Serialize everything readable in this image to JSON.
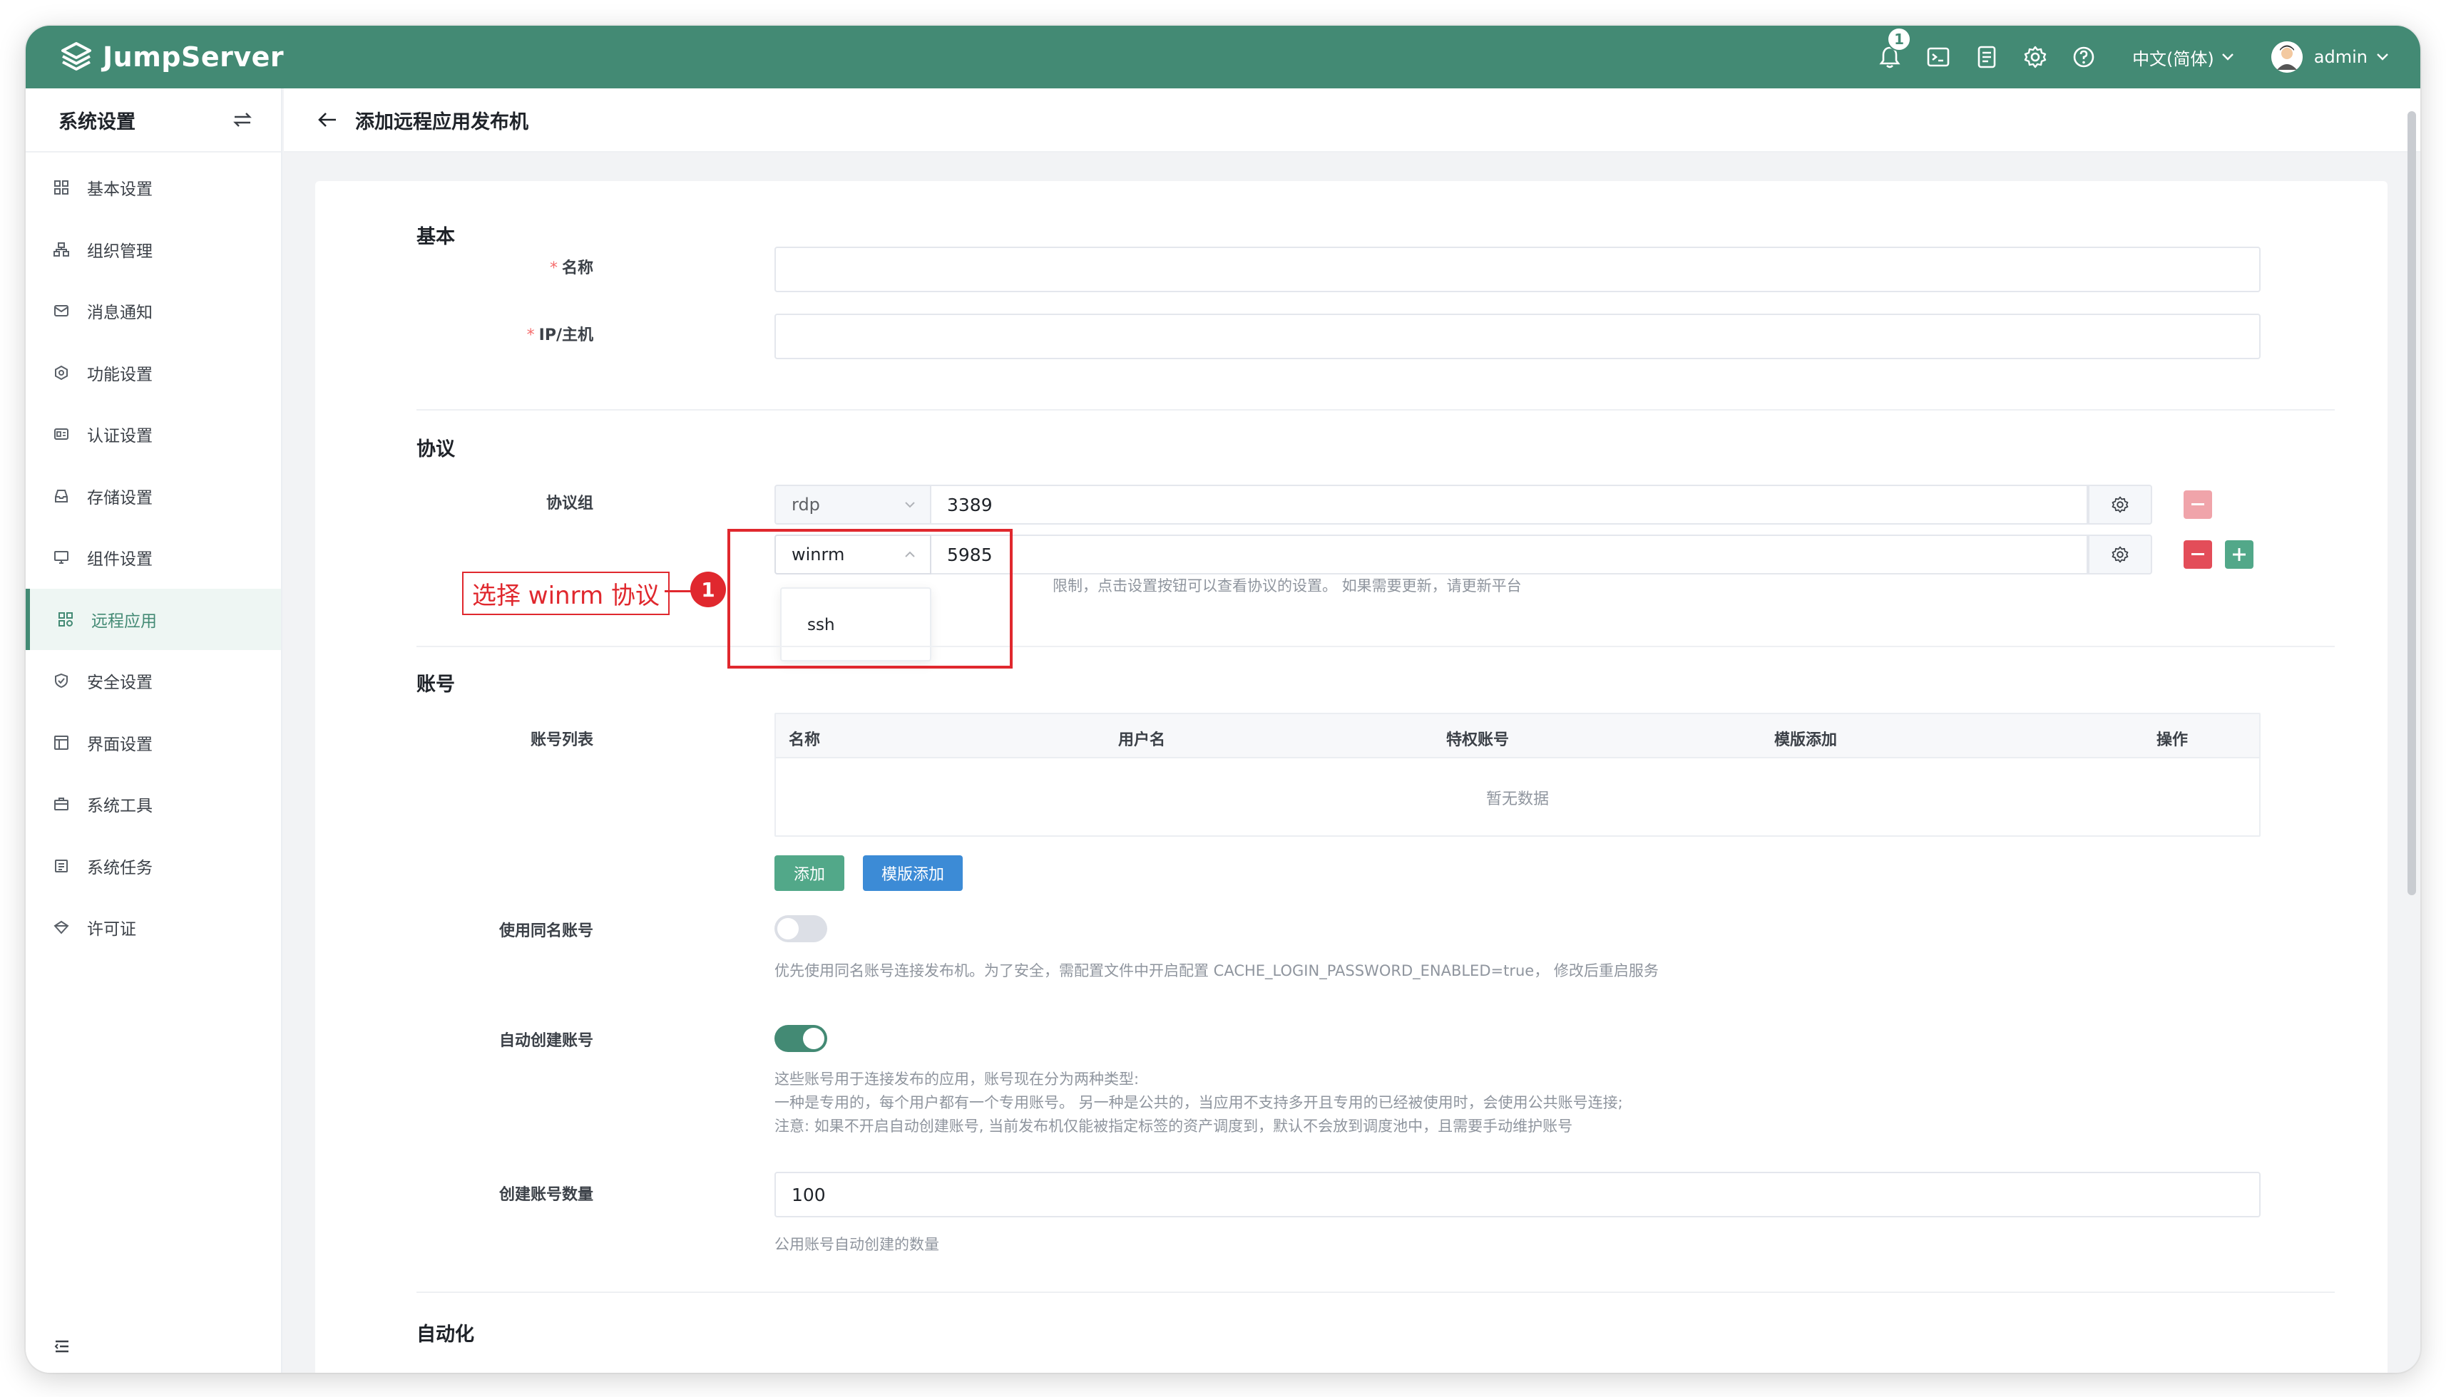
{
  "header": {
    "logo_text": "JumpServer",
    "notification_count": "1",
    "language": "中文(简体)",
    "username": "admin",
    "accent_color": "#438a74"
  },
  "sidebar": {
    "title": "系统设置",
    "items": [
      {
        "label": "基本设置",
        "icon": "grid-icon"
      },
      {
        "label": "组织管理",
        "icon": "org-icon"
      },
      {
        "label": "消息通知",
        "icon": "message-icon"
      },
      {
        "label": "功能设置",
        "icon": "feature-icon"
      },
      {
        "label": "认证设置",
        "icon": "id-card-icon"
      },
      {
        "label": "存储设置",
        "icon": "storage-icon"
      },
      {
        "label": "组件设置",
        "icon": "monitor-icon"
      },
      {
        "label": "远程应用",
        "icon": "apps-icon",
        "active": true
      },
      {
        "label": "安全设置",
        "icon": "shield-icon"
      },
      {
        "label": "界面设置",
        "icon": "layout-icon"
      },
      {
        "label": "系统工具",
        "icon": "toolbox-icon"
      },
      {
        "label": "系统任务",
        "icon": "task-icon"
      },
      {
        "label": "许可证",
        "icon": "license-icon"
      }
    ]
  },
  "page": {
    "title": "添加远程应用发布机"
  },
  "form": {
    "basic": {
      "section": "基本",
      "name_label": "名称",
      "name_value": "",
      "host_label": "IP/主机",
      "host_value": ""
    },
    "protocols": {
      "section": "协议",
      "group_label": "协议组",
      "rows": [
        {
          "protocol": "rdp",
          "port": "3389"
        },
        {
          "protocol": "winrm",
          "port": "5985"
        }
      ],
      "dropdown_option": "ssh",
      "hint_visible": "限制，点击设置按钮可以查看协议的设置。 如果需要更新，请更新平台"
    },
    "accounts": {
      "section": "账号",
      "list_label": "账号列表",
      "columns": [
        "名称",
        "用户名",
        "特权账号",
        "模版添加",
        "操作"
      ],
      "empty_text": "暂无数据",
      "add_button": "添加",
      "template_button": "模版添加"
    },
    "same_name": {
      "label": "使用同名账号",
      "enabled": false,
      "hint": "优先使用同名账号连接发布机。为了安全，需配置文件中开启配置 CACHE_LOGIN_PASSWORD_ENABLED=true， 修改后重启服务"
    },
    "auto_create": {
      "label": "自动创建账号",
      "enabled": true,
      "hint_lines": [
        "这些账号用于连接发布的应用，账号现在分为两种类型:",
        "一种是专用的，每个用户都有一个专用账号。 另一种是公共的，当应用不支持多开且专用的已经被使用时，会使用公共账号连接;",
        "注意: 如果不开启自动创建账号, 当前发布机仅能被指定标签的资产调度到，默认不会放到调度池中，且需要手动维护账号"
      ]
    },
    "account_count": {
      "label": "创建账号数量",
      "value": "100",
      "hint": "公用账号自动创建的数量"
    },
    "automation": {
      "section": "自动化"
    }
  },
  "annotation": {
    "text": "选择 winrm 协议",
    "number": "1",
    "color": "#e0282e"
  }
}
